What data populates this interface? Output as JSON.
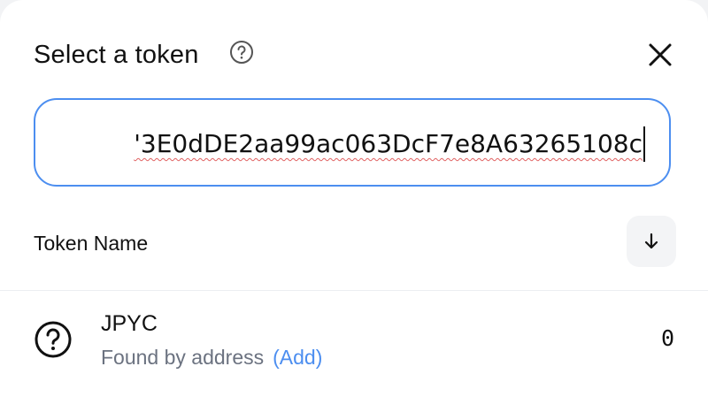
{
  "modal": {
    "title": "Select a token"
  },
  "search": {
    "value": "'3E0dDE2aa99ac063DcF7e8A63265108c"
  },
  "list_header": {
    "label": "Token Name"
  },
  "token": {
    "symbol": "JPYC",
    "subtitle": "Found by address",
    "add_label": "(Add)",
    "balance": "0"
  },
  "icons": {
    "help": "question-circle-icon",
    "close": "close-icon",
    "sort": "arrow-down-icon",
    "token": "unknown-token-question-icon"
  },
  "colors": {
    "accent": "#4c8ef0",
    "text": "#111111",
    "muted": "#6b7280",
    "spellcheck": "#e06060"
  }
}
